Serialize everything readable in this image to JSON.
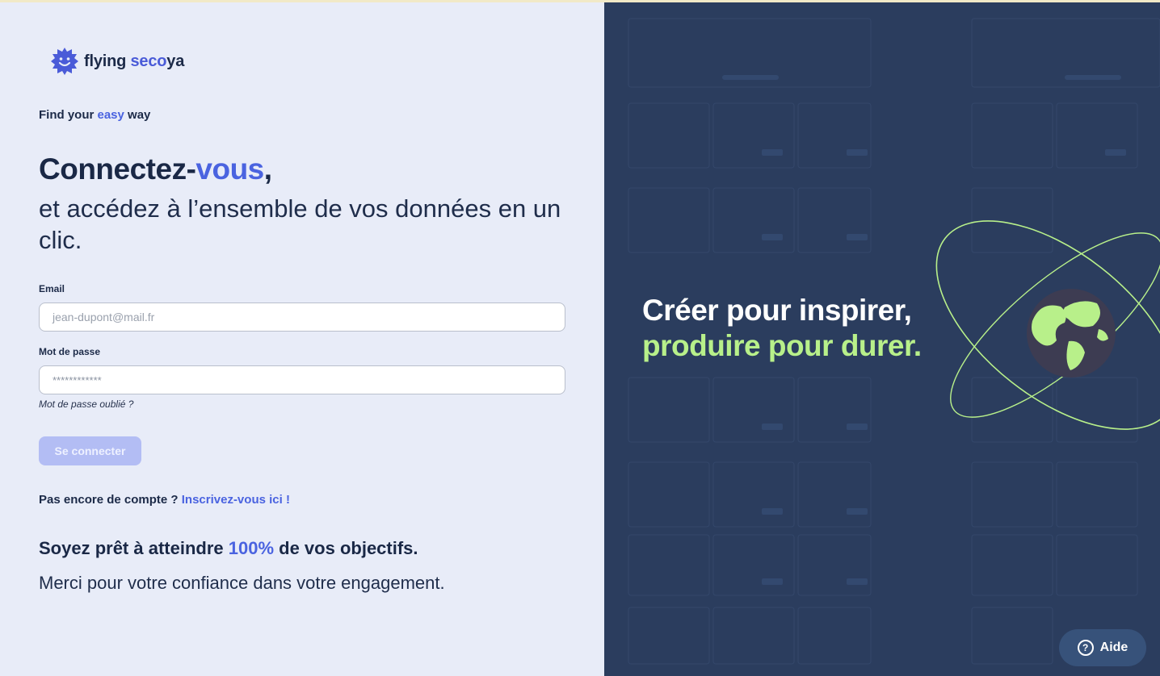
{
  "brand": {
    "name_part1": "flying ",
    "name_accent": "seco",
    "name_part2": "ya"
  },
  "tagline": {
    "before": "Find your ",
    "accent": "easy",
    "after": " way"
  },
  "headline": {
    "main": "Connectez-",
    "accent": "vous",
    "punct": ","
  },
  "subheadline": "et accédez à l’ensemble de vos données en un clic.",
  "form": {
    "email_label": "Email",
    "email_placeholder": "jean-dupont@mail.fr",
    "password_label": "Mot de passe",
    "password_value": "************",
    "forgot": "Mot de passe oublié ?",
    "submit": "Se connecter"
  },
  "signup": {
    "text": "Pas encore de compte ? ",
    "link": "Inscrivez-vous ici !"
  },
  "goal": {
    "before": "Soyez prêt à atteindre ",
    "accent": "100%",
    "after": " de vos objectifs."
  },
  "thanks": "Merci pour votre confiance dans votre engagement.",
  "hero": {
    "line1": "Créer pour inspirer,",
    "line2": "produire pour durer."
  },
  "help": {
    "label": "Aide",
    "icon_glyph": "?"
  },
  "colors": {
    "accent": "#4a63e0",
    "panel": "#2b3d5e",
    "hero_accent": "#b8f08a",
    "button_disabled": "#b3bdf4"
  },
  "icons": {
    "logo": "sun-smile-icon",
    "help": "question-circle-icon",
    "globe": "globe-icon"
  }
}
